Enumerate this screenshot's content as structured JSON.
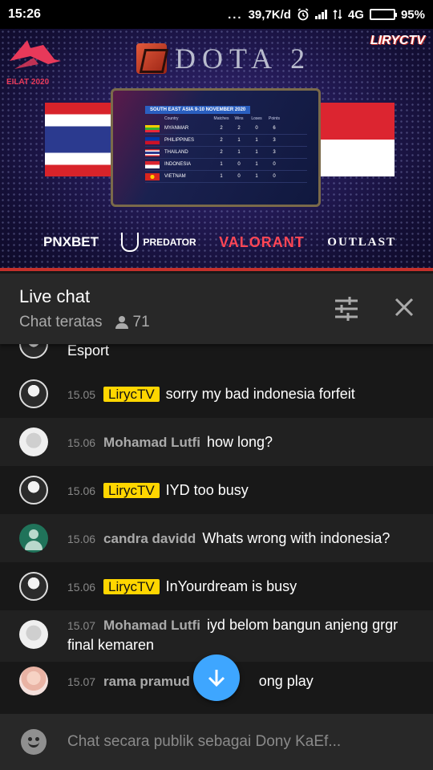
{
  "status_bar": {
    "time": "15:26",
    "more": "...",
    "speed": "39,7K/d",
    "network": "4G",
    "battery": "95%",
    "battery_level": 0.95
  },
  "video": {
    "event_logo_text": "EILAT 2020",
    "game_title": "DOTA 2",
    "channel_logo": "LIRYCTV",
    "standings": {
      "heading": "SOUTH EAST ASIA   9-10 NOVEMBER 2020",
      "columns": [
        "Country",
        "Matches",
        "Wins",
        "Loses",
        "Points"
      ],
      "rows": [
        {
          "country": "MYANMAR",
          "matches": "2",
          "wins": "2",
          "loses": "0",
          "points": "6",
          "flag": "myanmar"
        },
        {
          "country": "PHILIPPINES",
          "matches": "2",
          "wins": "1",
          "loses": "1",
          "points": "3",
          "flag": "philippines"
        },
        {
          "country": "THAILAND",
          "matches": "2",
          "wins": "1",
          "loses": "1",
          "points": "3",
          "flag": "thailand"
        },
        {
          "country": "INDONESIA",
          "matches": "1",
          "wins": "0",
          "loses": "1",
          "points": "0",
          "flag": "indonesia"
        },
        {
          "country": "VIETNAM",
          "matches": "1",
          "wins": "0",
          "loses": "1",
          "points": "0",
          "flag": "vietnam"
        }
      ]
    },
    "sponsors": [
      "PNXBET",
      "PREDATOR",
      "VALORANT",
      "OUTLAST"
    ]
  },
  "chat_header": {
    "title": "Live chat",
    "mode": "Chat teratas",
    "viewer_count": "71"
  },
  "messages": [
    {
      "time": "",
      "author": "",
      "owner": false,
      "text": "Esport",
      "avatar": "lyric"
    },
    {
      "time": "15.05",
      "author": "LirycTV",
      "owner": true,
      "text": "sorry my bad indonesia forfeit",
      "avatar": "lyric"
    },
    {
      "time": "15.06",
      "author": "Mohamad Lutfi",
      "owner": false,
      "text": "how long?",
      "avatar": "lutfi"
    },
    {
      "time": "15.06",
      "author": "LirycTV",
      "owner": true,
      "text": "IYD too busy",
      "avatar": "lyric"
    },
    {
      "time": "15.06",
      "author": "candra davidd",
      "owner": false,
      "text": "Whats wrong with indonesia?",
      "avatar": "candra"
    },
    {
      "time": "15.06",
      "author": "LirycTV",
      "owner": true,
      "text": "InYourdream is busy",
      "avatar": "lyric"
    },
    {
      "time": "15.07",
      "author": "Mohamad Lutfi",
      "owner": false,
      "text": "iyd belom bangun anjeng grgr final kemaren",
      "avatar": "lutfi"
    },
    {
      "time": "15.07",
      "author": "rama pramud",
      "owner": false,
      "text": "ong play",
      "avatar": "rama"
    }
  ],
  "input": {
    "placeholder": "Chat secara publik sebagai Dony KaEf..."
  },
  "colors": {
    "background": "#181818",
    "header": "#282828",
    "owner_badge": "#ffd600",
    "accent_blue": "#3ea6ff",
    "youtube_red": "#c4302b"
  },
  "icons": {
    "tune": "tune-icon",
    "close": "close-icon",
    "person": "person-icon",
    "emoji": "emoji-icon",
    "scroll_down": "arrow-down-icon"
  }
}
